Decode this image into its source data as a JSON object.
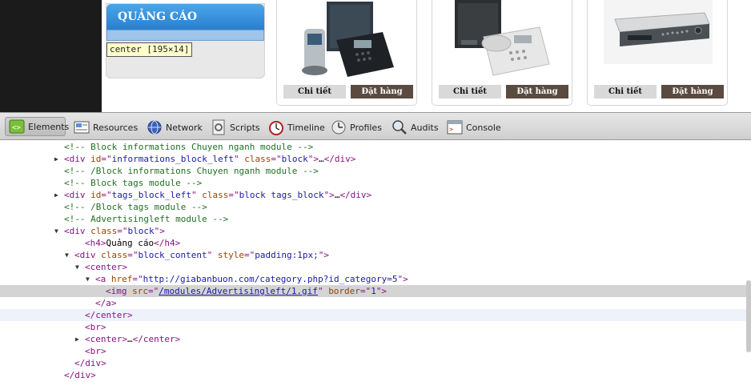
{
  "ad_block": {
    "title": "QUẢNG CÁO"
  },
  "inspect_tooltip": "center [195×14]",
  "products": [
    {
      "detail_label": "Chi tiết",
      "order_label": "Đặt hàng",
      "image": "ip-phone-system"
    },
    {
      "detail_label": "Chi tiết",
      "order_label": "Đặt hàng",
      "image": "pbx-phone"
    },
    {
      "detail_label": "Chi tiết",
      "order_label": "Đặt hàng",
      "image": "dvr-recorder"
    }
  ],
  "devtools": {
    "tabs": [
      {
        "label": "Elements",
        "icon": "elements-icon",
        "selected": true
      },
      {
        "label": "Resources",
        "icon": "resources-icon"
      },
      {
        "label": "Network",
        "icon": "network-icon"
      },
      {
        "label": "Scripts",
        "icon": "scripts-icon"
      },
      {
        "label": "Timeline",
        "icon": "timeline-icon"
      },
      {
        "label": "Profiles",
        "icon": "profiles-icon"
      },
      {
        "label": "Audits",
        "icon": "audits-icon"
      },
      {
        "label": "Console",
        "icon": "console-icon"
      }
    ],
    "dom_lines": [
      {
        "indent": 5,
        "tri": "",
        "parts": [
          [
            "comment",
            "<!-- Block informations Chuyen nganh module -->"
          ]
        ]
      },
      {
        "indent": 5,
        "tri": "right",
        "parts": [
          [
            "tag",
            "<div "
          ],
          [
            "attr",
            "id"
          ],
          [
            "tag",
            "=\""
          ],
          [
            "val",
            "informations_block_left"
          ],
          [
            "tag",
            "\" "
          ],
          [
            "attr",
            "class"
          ],
          [
            "tag",
            "=\""
          ],
          [
            "val",
            "block"
          ],
          [
            "tag",
            "\">"
          ],
          [
            "text",
            "…"
          ],
          [
            "tag",
            "</div>"
          ]
        ]
      },
      {
        "indent": 5,
        "tri": "",
        "parts": [
          [
            "comment",
            "<!-- /Block informations Chuyen nganh module -->"
          ]
        ]
      },
      {
        "indent": 5,
        "tri": "",
        "parts": [
          [
            "comment",
            "<!-- Block tags module -->"
          ]
        ]
      },
      {
        "indent": 5,
        "tri": "right",
        "parts": [
          [
            "tag",
            "<div "
          ],
          [
            "attr",
            "id"
          ],
          [
            "tag",
            "=\""
          ],
          [
            "val",
            "tags_block_left"
          ],
          [
            "tag",
            "\" "
          ],
          [
            "attr",
            "class"
          ],
          [
            "tag",
            "=\""
          ],
          [
            "val",
            "block tags_block"
          ],
          [
            "tag",
            "\">"
          ],
          [
            "text",
            "…"
          ],
          [
            "tag",
            "</div>"
          ]
        ]
      },
      {
        "indent": 5,
        "tri": "",
        "parts": [
          [
            "comment",
            "<!-- /Block tags module -->"
          ]
        ]
      },
      {
        "indent": 5,
        "tri": "",
        "parts": [
          [
            "comment",
            "<!-- Advertisingleft module -->"
          ]
        ]
      },
      {
        "indent": 5,
        "tri": "down",
        "parts": [
          [
            "tag",
            "<div "
          ],
          [
            "attr",
            "class"
          ],
          [
            "tag",
            "=\""
          ],
          [
            "val",
            "block"
          ],
          [
            "tag",
            "\">"
          ]
        ]
      },
      {
        "indent": 7,
        "tri": "",
        "parts": [
          [
            "tag",
            "<h4>"
          ],
          [
            "text",
            "Quảng cáo"
          ],
          [
            "tag",
            "</h4>"
          ]
        ]
      },
      {
        "indent": 6,
        "tri": "down",
        "parts": [
          [
            "tag",
            "<div "
          ],
          [
            "attr",
            "class"
          ],
          [
            "tag",
            "=\""
          ],
          [
            "val",
            "block_content"
          ],
          [
            "tag",
            "\" "
          ],
          [
            "attr",
            "style"
          ],
          [
            "tag",
            "=\""
          ],
          [
            "val",
            "padding:1px;"
          ],
          [
            "tag",
            "\">"
          ]
        ]
      },
      {
        "indent": 7,
        "tri": "down",
        "parts": [
          [
            "tag",
            "<center>"
          ]
        ]
      },
      {
        "indent": 8,
        "tri": "down",
        "parts": [
          [
            "tag",
            "<a "
          ],
          [
            "attr",
            "href"
          ],
          [
            "tag",
            "=\""
          ],
          [
            "val",
            "http://giabanbuon.com/category.php?id_category=5"
          ],
          [
            "tag",
            "\">"
          ]
        ]
      },
      {
        "indent": 9,
        "tri": "",
        "selected": true,
        "parts": [
          [
            "tag",
            "<img "
          ],
          [
            "attr",
            "src"
          ],
          [
            "tag",
            "=\""
          ],
          [
            "link",
            "/modules/Advertisingleft/1.gif"
          ],
          [
            "tag",
            "\" "
          ],
          [
            "attr",
            "border"
          ],
          [
            "tag",
            "=\""
          ],
          [
            "val",
            "1"
          ],
          [
            "tag",
            "\">"
          ]
        ]
      },
      {
        "indent": 8,
        "tri": "",
        "parts": [
          [
            "tag",
            "</a>"
          ]
        ]
      },
      {
        "indent": 7,
        "tri": "",
        "hover": true,
        "parts": [
          [
            "tag",
            "</center>"
          ]
        ]
      },
      {
        "indent": 7,
        "tri": "",
        "parts": [
          [
            "tag",
            "<br>"
          ]
        ]
      },
      {
        "indent": 7,
        "tri": "right",
        "parts": [
          [
            "tag",
            "<center>"
          ],
          [
            "text",
            "…"
          ],
          [
            "tag",
            "</center>"
          ]
        ]
      },
      {
        "indent": 7,
        "tri": "",
        "parts": [
          [
            "tag",
            "<br>"
          ]
        ]
      },
      {
        "indent": 6,
        "tri": "",
        "parts": [
          [
            "tag",
            "</div>"
          ]
        ]
      },
      {
        "indent": 5,
        "tri": "",
        "parts": [
          [
            "tag",
            "</div>"
          ]
        ]
      }
    ]
  }
}
